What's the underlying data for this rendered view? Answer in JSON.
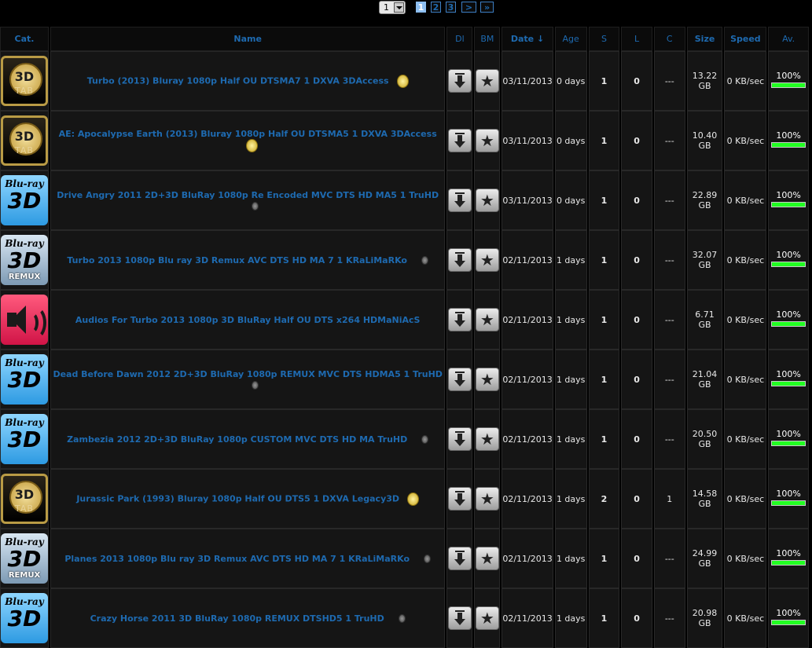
{
  "pagination": {
    "select_value": "1",
    "pages": [
      "1",
      "2",
      "3"
    ],
    "current_page": "1",
    "next_label": ">",
    "last_label": "»"
  },
  "columns": {
    "cat": "Cat.",
    "name": "Name",
    "dl": "Dl",
    "bm": "BM",
    "date": "Date ↓",
    "age": "Age",
    "seeders": "S",
    "leechers": "L",
    "comments": "C",
    "size": "Size",
    "speed": "Speed",
    "avail": "Av."
  },
  "category_icons": {
    "tab3d": {
      "line1": "3D",
      "line2": "TAB"
    },
    "bluray": {
      "line1": "Blu-ray",
      "line2": "3D"
    },
    "bluray_remux": {
      "line1": "Blu-ray",
      "line2": "3D",
      "line3": "REMUX"
    }
  },
  "rows": [
    {
      "category": "3D TAB",
      "icon": "tab3d",
      "name": "Turbo (2013) Bluray 1080p Half OU DTSMA7 1 DXVA 3DAccess",
      "coin": "gold",
      "date": "03/11/2013",
      "age": "0 days",
      "seeders": "1",
      "leechers": "0",
      "comments": "---",
      "size": "13.22 GB",
      "speed": "0 KB/sec",
      "avail": "100%",
      "avail_fraction": 1.0
    },
    {
      "category": "3D TAB",
      "icon": "tab3d",
      "name": "AE: Apocalypse Earth (2013) Bluray 1080p Half OU DTSMA5 1 DXVA 3DAccess",
      "coin": "gold",
      "date": "03/11/2013",
      "age": "0 days",
      "seeders": "1",
      "leechers": "0",
      "comments": "---",
      "size": "10.40 GB",
      "speed": "0 KB/sec",
      "avail": "100%",
      "avail_fraction": 1.0
    },
    {
      "category": "Blu-ray 3D",
      "icon": "bluray",
      "name": "Drive Angry 2011 2D+3D BluRay 1080p Re Encoded MVC DTS HD MA5 1 TruHD",
      "coin": "grey",
      "date": "03/11/2013",
      "age": "0 days",
      "seeders": "1",
      "leechers": "0",
      "comments": "---",
      "size": "22.89 GB",
      "speed": "0 KB/sec",
      "avail": "100%",
      "avail_fraction": 1.0
    },
    {
      "category": "Blu-ray 3D REMUX",
      "icon": "bluray_remux",
      "name": "Turbo 2013 1080p Blu ray 3D Remux AVC DTS HD MA 7 1 KRaLiMaRKo",
      "coin": "grey",
      "date": "02/11/2013",
      "age": "1 days",
      "seeders": "1",
      "leechers": "0",
      "comments": "---",
      "size": "32.07 GB",
      "speed": "0 KB/sec",
      "avail": "100%",
      "avail_fraction": 1.0
    },
    {
      "category": "Audio",
      "icon": "audio",
      "name": "Audios For Turbo 2013 1080p 3D BluRay Half OU DTS x264 HDMaNiAcS",
      "coin": "none",
      "date": "02/11/2013",
      "age": "1 days",
      "seeders": "1",
      "leechers": "0",
      "comments": "---",
      "size": "6.71 GB",
      "speed": "0 KB/sec",
      "avail": "100%",
      "avail_fraction": 1.0
    },
    {
      "category": "Blu-ray 3D",
      "icon": "bluray",
      "name": "Dead Before Dawn 2012 2D+3D BluRay 1080p REMUX MVC DTS HDMA5 1 TruHD",
      "coin": "grey",
      "date": "02/11/2013",
      "age": "1 days",
      "seeders": "1",
      "leechers": "0",
      "comments": "---",
      "size": "21.04 GB",
      "speed": "0 KB/sec",
      "avail": "100%",
      "avail_fraction": 1.0
    },
    {
      "category": "Blu-ray 3D",
      "icon": "bluray",
      "name": "Zambezia 2012 2D+3D BluRay 1080p CUSTOM MVC DTS HD MA TruHD",
      "coin": "grey",
      "date": "02/11/2013",
      "age": "1 days",
      "seeders": "1",
      "leechers": "0",
      "comments": "---",
      "size": "20.50 GB",
      "speed": "0 KB/sec",
      "avail": "100%",
      "avail_fraction": 1.0
    },
    {
      "category": "3D TAB",
      "icon": "tab3d",
      "name": "Jurassic Park (1993) Bluray 1080p Half OU DTS5 1 DXVA Legacy3D",
      "coin": "gold",
      "date": "02/11/2013",
      "age": "1 days",
      "seeders": "2",
      "leechers": "0",
      "comments": "1",
      "size": "14.58 GB",
      "speed": "0 KB/sec",
      "avail": "100%",
      "avail_fraction": 1.0
    },
    {
      "category": "Blu-ray 3D REMUX",
      "icon": "bluray_remux",
      "name": "Planes 2013 1080p Blu ray 3D Remux AVC DTS HD MA 7 1 KRaLiMaRKo",
      "coin": "grey",
      "date": "02/11/2013",
      "age": "1 days",
      "seeders": "1",
      "leechers": "0",
      "comments": "---",
      "size": "24.99 GB",
      "speed": "0 KB/sec",
      "avail": "100%",
      "avail_fraction": 1.0
    },
    {
      "category": "Blu-ray 3D",
      "icon": "bluray",
      "name": "Crazy Horse 2011 3D BluRay 1080p REMUX DTSHD5 1 TruHD",
      "coin": "grey",
      "date": "02/11/2013",
      "age": "1 days",
      "seeders": "1",
      "leechers": "0",
      "comments": "---",
      "size": "20.98 GB",
      "speed": "0 KB/sec",
      "avail": "100%",
      "avail_fraction": 1.0
    }
  ],
  "icons": {
    "download": "download-arrow-icon",
    "bookmark": "star-icon",
    "free": "gold-coin-icon",
    "status": "grey-dot-icon"
  }
}
